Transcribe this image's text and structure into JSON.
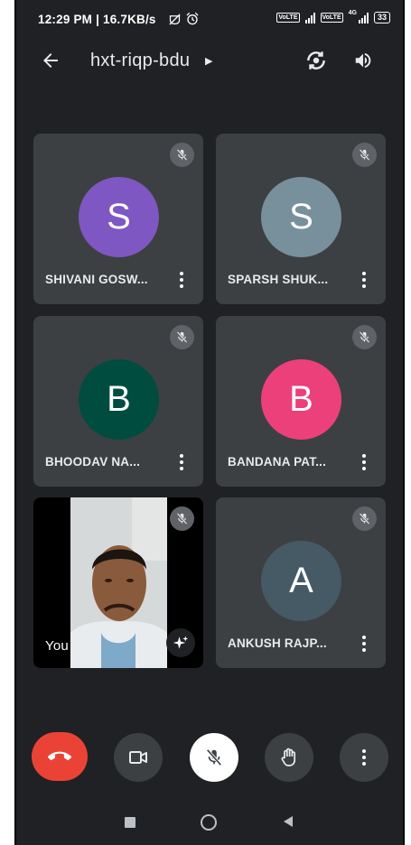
{
  "status_bar": {
    "time_and_speed": "12:29 PM | 16.7KB/s",
    "sim1_tag": "VoLTE",
    "sim2_tag": "VoLTE",
    "network_type": "4G",
    "battery_level": "33"
  },
  "meeting": {
    "code": "hxt-riqp-bdu"
  },
  "participants": [
    {
      "initial": "S",
      "name": "SHIVANI GOSW...",
      "avatar_color": "#7e57c2",
      "muted": true
    },
    {
      "initial": "S",
      "name": "SPARSH SHUK...",
      "avatar_color": "#78909c",
      "muted": true
    },
    {
      "initial": "B",
      "name": "BHOODAV NA...",
      "avatar_color": "#004d40",
      "muted": true
    },
    {
      "initial": "B",
      "name": "BANDANA PAT...",
      "avatar_color": "#ec407a",
      "muted": true
    },
    {
      "initial": "A",
      "name": "ANKUSH RAJP...",
      "avatar_color": "#455a64",
      "muted": true
    }
  ],
  "self_tile": {
    "label": "You",
    "muted": true,
    "effects_icon": "sparkle-icon"
  },
  "controls": {
    "end_call_color": "#ea4335",
    "button_dark": "#3c4043",
    "mic_button_bg": "#ffffff",
    "icons": [
      "end-call-icon",
      "camera-icon",
      "mic-off-icon",
      "raise-hand-icon",
      "more-options-icon"
    ]
  },
  "nav": {
    "icons": [
      "recents-square-icon",
      "home-circle-icon",
      "back-triangle-icon"
    ]
  }
}
